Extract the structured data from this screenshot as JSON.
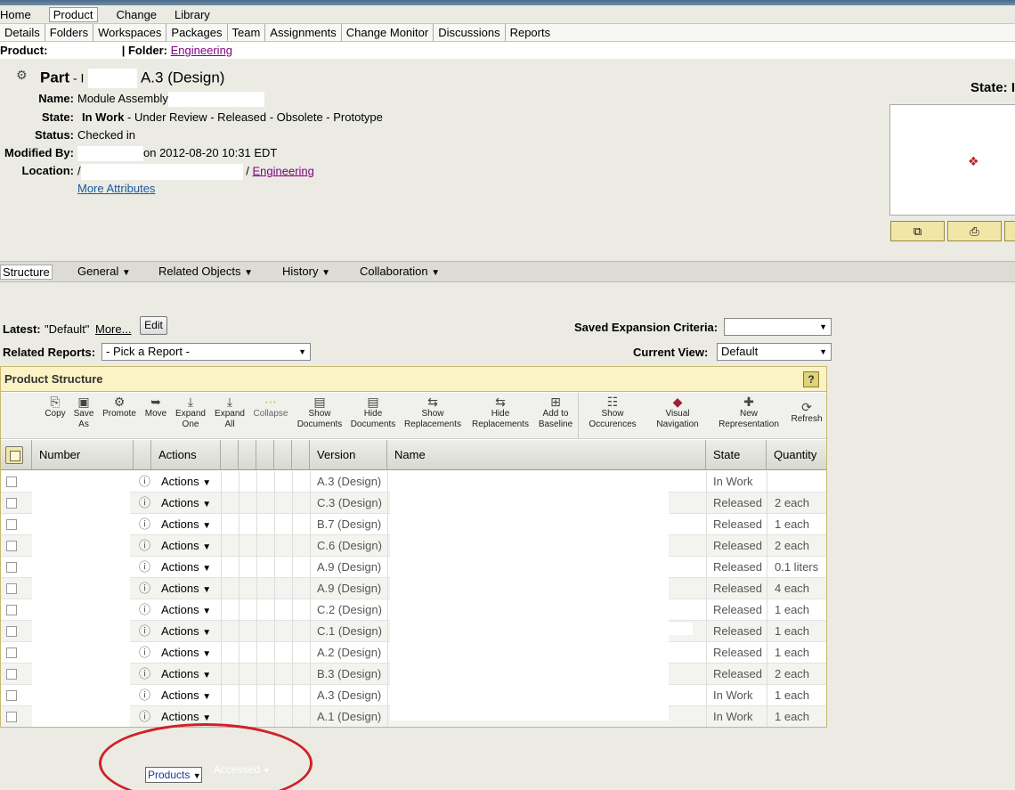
{
  "menu_top": [
    "Home",
    "Product",
    "Change",
    "Library"
  ],
  "menu_top_active": "Product",
  "menu_sub": [
    "Details",
    "Folders",
    "Workspaces",
    "Packages",
    "Team",
    "Assignments",
    "Change Monitor",
    "Discussions",
    "Reports"
  ],
  "context": {
    "product_label": "Product:",
    "folder_label": "| Folder:",
    "folder_link": "Engineering"
  },
  "part": {
    "title_prefix": "Part",
    "title_dash": " - I",
    "title_version": "A.3 (Design)",
    "name_label": "Name:",
    "name_value": "Module Assembly",
    "state_label": "State:",
    "state_current": "In Work",
    "state_rest": " - Under Review - Released - Obsolete - Prototype",
    "status_label": "Status:",
    "status_value": "Checked in",
    "modified_label": "Modified By:",
    "modified_value": "on 2012-08-20 10:31 EDT",
    "location_label": "Location:",
    "location_prefix": "/",
    "location_sep": "/",
    "location_link": "Engineering",
    "more_attributes": "More Attributes",
    "right_state_label": "State: I"
  },
  "tabs": [
    "Structure",
    "General",
    "Related Objects",
    "History",
    "Collaboration"
  ],
  "tab_active": "Structure",
  "controls": {
    "latest_label": "Latest:",
    "latest_value": "\"Default\"",
    "more_link": "More...",
    "edit_button": "Edit",
    "related_reports_label": "Related Reports:",
    "related_reports_value": "- Pick a Report -",
    "saved_expansion_label": "Saved Expansion Criteria:",
    "saved_expansion_value": "",
    "current_view_label": "Current View:",
    "current_view_value": "Default"
  },
  "product_structure": {
    "title": "Product Structure",
    "help": "?",
    "toolbar": [
      {
        "label": "Copy",
        "icon": "copy-icon",
        "glyph": "⎘"
      },
      {
        "label": "Save As",
        "icon": "save-as-icon",
        "glyph": "▣"
      },
      {
        "label": "Promote",
        "icon": "promote-icon",
        "glyph": "⚙"
      },
      {
        "label": "Move",
        "icon": "move-icon",
        "glyph": "➥"
      },
      {
        "label": "Expand One",
        "icon": "expand-one-icon",
        "glyph": "⤓"
      },
      {
        "label": "Expand All",
        "icon": "expand-all-icon",
        "glyph": "⤓"
      },
      {
        "label": "Collapse",
        "icon": "collapse-icon",
        "glyph": "⋯"
      },
      {
        "label": "Show Documents",
        "icon": "show-documents-icon",
        "glyph": "▤"
      },
      {
        "label": "Hide Documents",
        "icon": "hide-documents-icon",
        "glyph": "▤"
      },
      {
        "label": "Show Replacements",
        "icon": "show-replacements-icon",
        "glyph": "⇆"
      },
      {
        "label": "Hide Replacements",
        "icon": "hide-replacements-icon",
        "glyph": "⇆"
      },
      {
        "label": "Add to Baseline",
        "icon": "add-to-baseline-icon",
        "glyph": "⊞"
      },
      {
        "label": "Show Occurences",
        "icon": "show-occurences-icon",
        "glyph": "☷"
      },
      {
        "label": "Visual Navigation",
        "icon": "visual-navigation-icon",
        "glyph": "◆"
      },
      {
        "label": "New Representation",
        "icon": "new-representation-icon",
        "glyph": "✚"
      },
      {
        "label": "Refresh",
        "icon": "refresh-icon",
        "glyph": "⟳"
      }
    ],
    "columns": [
      "Number",
      "Actions",
      "Version",
      "Name",
      "State",
      "Quantity"
    ],
    "rows": [
      {
        "actions": "Actions",
        "version": "A.3 (Design)",
        "state": "In Work",
        "quantity": ""
      },
      {
        "actions": "Actions",
        "version": "C.3 (Design)",
        "state": "Released",
        "quantity": "2 each"
      },
      {
        "actions": "Actions",
        "version": "B.7 (Design)",
        "state": "Released",
        "quantity": "1 each"
      },
      {
        "actions": "Actions",
        "version": "C.6 (Design)",
        "state": "Released",
        "quantity": "2 each"
      },
      {
        "actions": "Actions",
        "version": "A.9 (Design)",
        "state": "Released",
        "quantity": "0.1 liters"
      },
      {
        "actions": "Actions",
        "version": "A.9 (Design)",
        "state": "Released",
        "quantity": "4 each"
      },
      {
        "actions": "Actions",
        "version": "C.2 (Design)",
        "state": "Released",
        "quantity": "1 each"
      },
      {
        "actions": "Actions",
        "version": "C.1 (Design)",
        "state": "Released",
        "quantity": "1 each"
      },
      {
        "actions": "Actions",
        "version": "A.2 (Design)",
        "state": "Released",
        "quantity": "1 each"
      },
      {
        "actions": "Actions",
        "version": "B.3 (Design)",
        "state": "Released",
        "quantity": "2 each"
      },
      {
        "actions": "Actions",
        "version": "A.3 (Design)",
        "state": "In Work",
        "quantity": "1 each"
      },
      {
        "actions": "Actions",
        "version": "A.1 (Design)",
        "state": "In Work",
        "quantity": "1 each"
      }
    ]
  },
  "bottom": {
    "products_label": "Products",
    "accessed_label": "Accessed"
  },
  "colors": {
    "annotation_circle": "#d0202a",
    "header_yellow": "#fbf3c4"
  }
}
